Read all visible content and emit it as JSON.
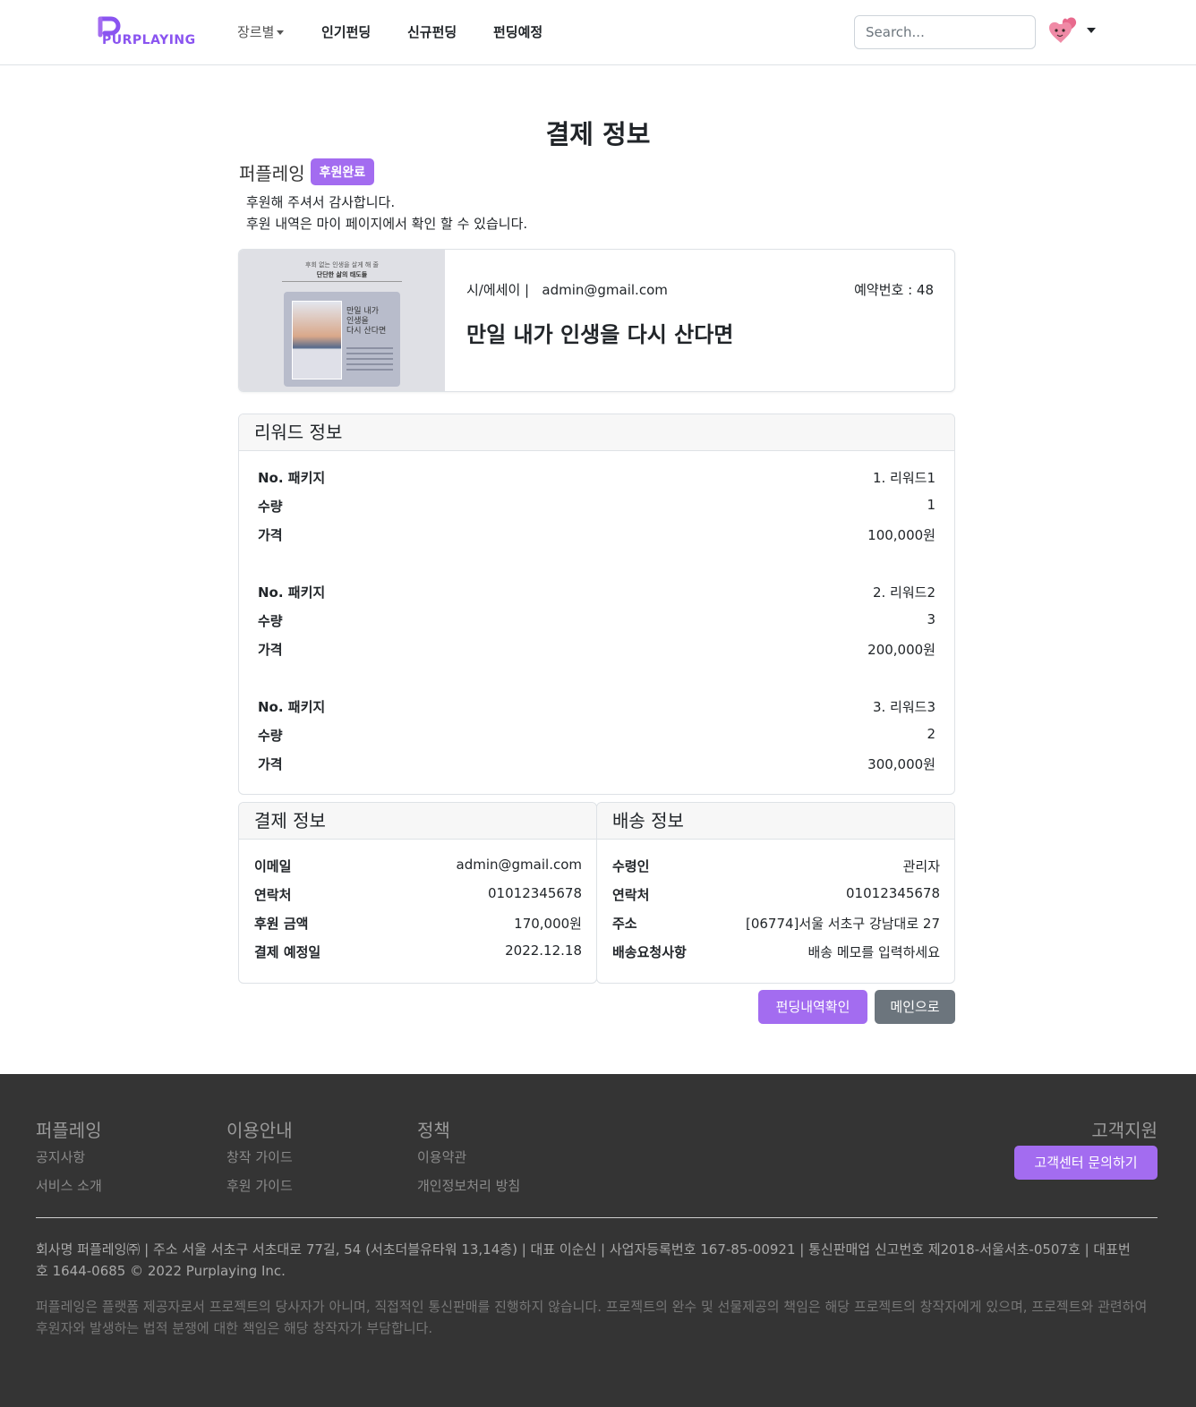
{
  "header": {
    "logo_text": "PURPLAYING",
    "nav": {
      "genre": "장르별",
      "popular": "인기펀딩",
      "new": "신규펀딩",
      "upcoming": "펀딩예정"
    },
    "search_placeholder": "Search..."
  },
  "main": {
    "title": "결제 정보",
    "brand": "퍼플레잉",
    "badge": "후원완료",
    "thanks_line1": "후원해 주셔서 감사합니다.",
    "thanks_line2": "후원 내역은 마이 페이지에서 확인 할 수 있습니다.",
    "product": {
      "cover_top1": "후회 없는 인생을 살게 해 줄",
      "cover_top2": "단단한 삶의 태도들",
      "cover_title": "만일 내가\n인생을\n다시 산다면",
      "category": "시/에세이 |",
      "email": "admin@gmail.com",
      "reservation": "예약번호 : 48",
      "title": "만일 내가 인생을 다시 산다면"
    },
    "reward": {
      "header": "리워드 정보",
      "package_label": "No. 패키지",
      "qty_label": "수량",
      "price_label": "가격",
      "items": [
        {
          "package": "1. 리워드1",
          "qty": "1",
          "price": "100,000원"
        },
        {
          "package": "2. 리워드2",
          "qty": "3",
          "price": "200,000원"
        },
        {
          "package": "3. 리워드3",
          "qty": "2",
          "price": "300,000원"
        }
      ]
    },
    "payment": {
      "header": "결제 정보",
      "rows": [
        {
          "label": "이메일",
          "value": "admin@gmail.com"
        },
        {
          "label": "연락처",
          "value": "01012345678"
        },
        {
          "label": "후원 금액",
          "value": "170,000원"
        },
        {
          "label": "결제 예정일",
          "value": "2022.12.18"
        }
      ]
    },
    "shipping": {
      "header": "배송 정보",
      "rows": [
        {
          "label": "수령인",
          "value": "관리자"
        },
        {
          "label": "연락처",
          "value": "01012345678"
        },
        {
          "label": "주소",
          "value": "[06774]서울 서초구 강남대로 27"
        },
        {
          "label": "배송요청사항",
          "value": "배송 메모를 입력하세요"
        }
      ]
    },
    "buttons": {
      "history": "펀딩내역확인",
      "main": "메인으로"
    }
  },
  "footer": {
    "col1": {
      "title": "퍼플레잉",
      "links": [
        "공지사항",
        "서비스 소개"
      ]
    },
    "col2": {
      "title": "이용안내",
      "links": [
        "창작 가이드",
        "후원 가이드"
      ]
    },
    "col3": {
      "title": "정책",
      "links": [
        "이용약관",
        "개인정보처리 방침"
      ]
    },
    "support": {
      "title": "고객지원",
      "button": "고객센터 문의하기"
    },
    "company_info": "회사명 퍼플레잉㈜ | 주소 서울 서초구 서초대로 77길, 54 (서초더블유타워 13,14층) | 대표 이순신 | 사업자등록번호 167-85-00921 | 통신판매업 신고번호 제2018-서울서초-0507호 | 대표번호 1644-0685 © 2022 Purplaying Inc.",
    "notice": "퍼플레잉은 플랫폼 제공자로서 프로젝트의 당사자가 아니며, 직접적인 통신판매를 진행하지 않습니다. 프로젝트의 완수 및 선물제공의 책임은 해당 프로젝트의 창작자에게 있으며, 프로젝트와 관련하여 후원자와 발생하는 법적 분쟁에 대한 책임은 해당 창작자가 부담합니다."
  }
}
